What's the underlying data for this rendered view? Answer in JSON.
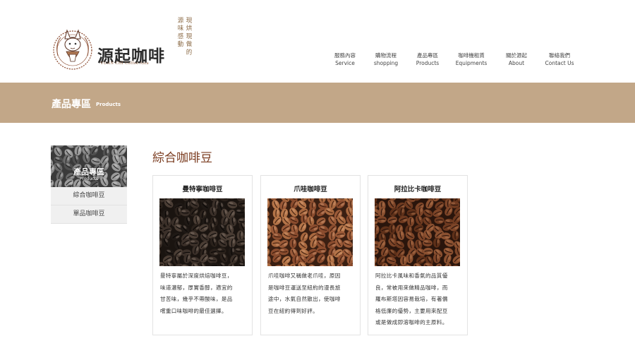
{
  "brand": {
    "name_cn": "源起咖啡",
    "name_en": "YUAN CHI Coffee Asia",
    "slogan_line1": "源 味 感 動",
    "slogan_line2": "現 烘 現 做 的"
  },
  "nav": [
    {
      "cn": "服務內容",
      "en": "Service"
    },
    {
      "cn": "購物流程",
      "en": "shopping"
    },
    {
      "cn": "產品專區",
      "en": "Products"
    },
    {
      "cn": "咖啡機租賃",
      "en": "Equipments"
    },
    {
      "cn": "關於源起",
      "en": "About"
    },
    {
      "cn": "聯絡我們",
      "en": "Contact Us"
    }
  ],
  "banner": {
    "title": "產品專區",
    "subtitle": "Products"
  },
  "sidebar": {
    "hero_title": "產品專區",
    "hero_sub": "Products",
    "items": [
      {
        "label": "綜合咖啡豆"
      },
      {
        "label": "單品咖啡豆"
      }
    ]
  },
  "main": {
    "section_title": "綜合咖啡豆",
    "products": [
      {
        "title": "曼特寧咖啡豆",
        "tone": "dark",
        "desc": [
          "曼特寧屬於深度烘焙咖啡豆，",
          "味道濃郁，厚實香醇，適宜的",
          "甘苦味，幾乎不帶酸味，是品",
          "嚐重口味咖啡的最佳選擇。"
        ]
      },
      {
        "title": "爪哇咖啡豆",
        "tone": "light",
        "desc": [
          "爪哇咖啡又稱做老爪哇，原因",
          "是咖啡豆運送至紐約的漫長旅",
          "途中，水氣自然散出，使咖啡",
          "豆在紐約得到好評。"
        ]
      },
      {
        "title": "阿拉比卡咖啡豆",
        "tone": "medium",
        "desc": [
          "阿拉比卡風味和香氣的品質優",
          "良，常被用來做精品咖啡，而",
          "羅布斯塔因容易栽培，有著價",
          "格低廉的優勢，主要用來配豆",
          "或是做成即溶咖啡的主原料。"
        ]
      }
    ]
  },
  "colors": {
    "banner_bg": "#c2a788",
    "title_accent": "#7a3b1f",
    "logo_brown": "#8a4a2e"
  }
}
